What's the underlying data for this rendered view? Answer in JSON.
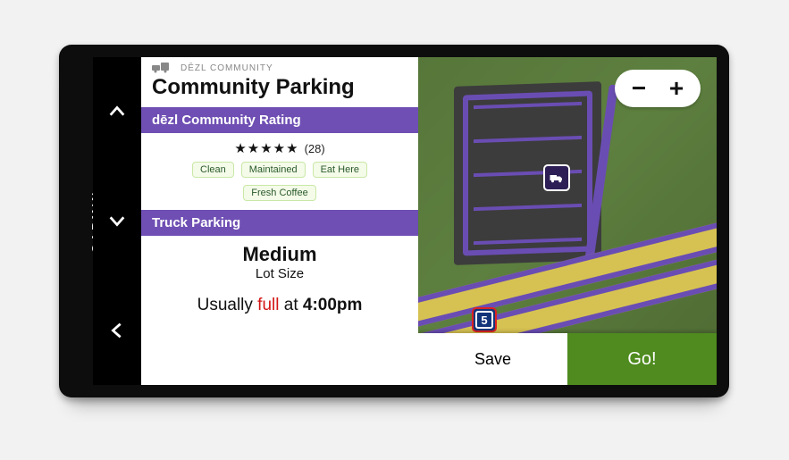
{
  "brand": "GARMIN",
  "header": {
    "community_brand": "DĒZL COMMUNITY",
    "title": "Community Parking"
  },
  "rating_section": {
    "label": "dēzl Community Rating",
    "stars": "★★★★★",
    "count_text": "(28)",
    "tags": [
      "Clean",
      "Maintained",
      "Eat Here",
      "Fresh Coffee"
    ]
  },
  "parking_section": {
    "label": "Truck Parking",
    "lot_value": "Medium",
    "lot_label": "Lot Size",
    "usually_prefix": "Usually ",
    "usually_status": "full",
    "usually_mid": " at ",
    "usually_time": "4:00pm"
  },
  "map": {
    "route_shield": "5",
    "zoom_out": "−",
    "zoom_in": "+"
  },
  "actions": {
    "save": "Save",
    "go": "Go!"
  }
}
